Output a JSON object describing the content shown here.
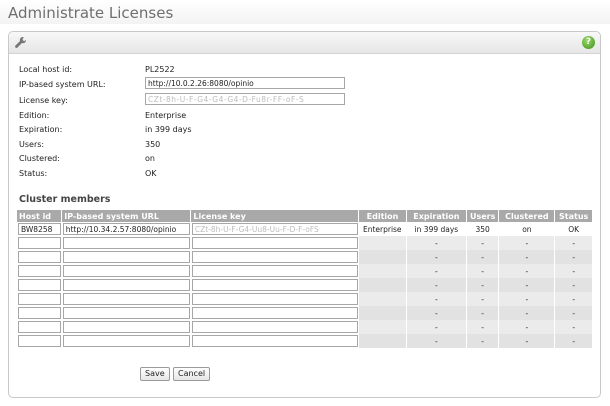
{
  "page": {
    "title": "Administrate Licenses"
  },
  "license_info": {
    "local_host_id": {
      "label": "Local host id:",
      "value": "PL2522"
    },
    "system_url": {
      "label": "IP-based system URL:",
      "value": "http://10.0.2.26:8080/opinio"
    },
    "license_key": {
      "label": "License key:",
      "value": "CZt-8h-U-F-G4-G4-G4-D-Fu8r-FF-oF-S"
    },
    "edition": {
      "label": "Edition:",
      "value": "Enterprise"
    },
    "expiration": {
      "label": "Expiration:",
      "value": "in 399 days"
    },
    "users": {
      "label": "Users:",
      "value": "350"
    },
    "clustered": {
      "label": "Clustered:",
      "value": "on"
    },
    "status": {
      "label": "Status:",
      "value": "OK"
    }
  },
  "cluster": {
    "heading": "Cluster members",
    "columns": [
      "Host id",
      "IP-based system URL",
      "License key",
      "Edition",
      "Expiration",
      "Users",
      "Clustered",
      "Status"
    ],
    "rows": [
      {
        "host_id": "BW8258",
        "url": "http://10.34.2.57:8080/opinio",
        "key": "CZt-8h-U-F-G4-Uu8-Uu-F-D-F-oFS",
        "edition": "Enterprise",
        "expiration": "in 399 days",
        "users": "350",
        "clustered": "on",
        "status": "OK"
      },
      {
        "host_id": "",
        "url": "",
        "key": "",
        "edition": "",
        "expiration": "-",
        "users": "-",
        "clustered": "-",
        "status": "-"
      },
      {
        "host_id": "",
        "url": "",
        "key": "",
        "edition": "",
        "expiration": "-",
        "users": "-",
        "clustered": "-",
        "status": "-"
      },
      {
        "host_id": "",
        "url": "",
        "key": "",
        "edition": "",
        "expiration": "-",
        "users": "-",
        "clustered": "-",
        "status": "-"
      },
      {
        "host_id": "",
        "url": "",
        "key": "",
        "edition": "",
        "expiration": "-",
        "users": "-",
        "clustered": "-",
        "status": "-"
      },
      {
        "host_id": "",
        "url": "",
        "key": "",
        "edition": "",
        "expiration": "-",
        "users": "-",
        "clustered": "-",
        "status": "-"
      },
      {
        "host_id": "",
        "url": "",
        "key": "",
        "edition": "",
        "expiration": "-",
        "users": "-",
        "clustered": "-",
        "status": "-"
      },
      {
        "host_id": "",
        "url": "",
        "key": "",
        "edition": "",
        "expiration": "-",
        "users": "-",
        "clustered": "-",
        "status": "-"
      },
      {
        "host_id": "",
        "url": "",
        "key": "",
        "edition": "",
        "expiration": "-",
        "users": "-",
        "clustered": "-",
        "status": "-"
      }
    ]
  },
  "buttons": {
    "save": "Save",
    "cancel": "Cancel"
  },
  "icons": {
    "tools": "wrench-icon",
    "help": "help-icon"
  },
  "colors": {
    "header_gray": "#a9a9a9",
    "help_green": "#3f8f1a"
  }
}
